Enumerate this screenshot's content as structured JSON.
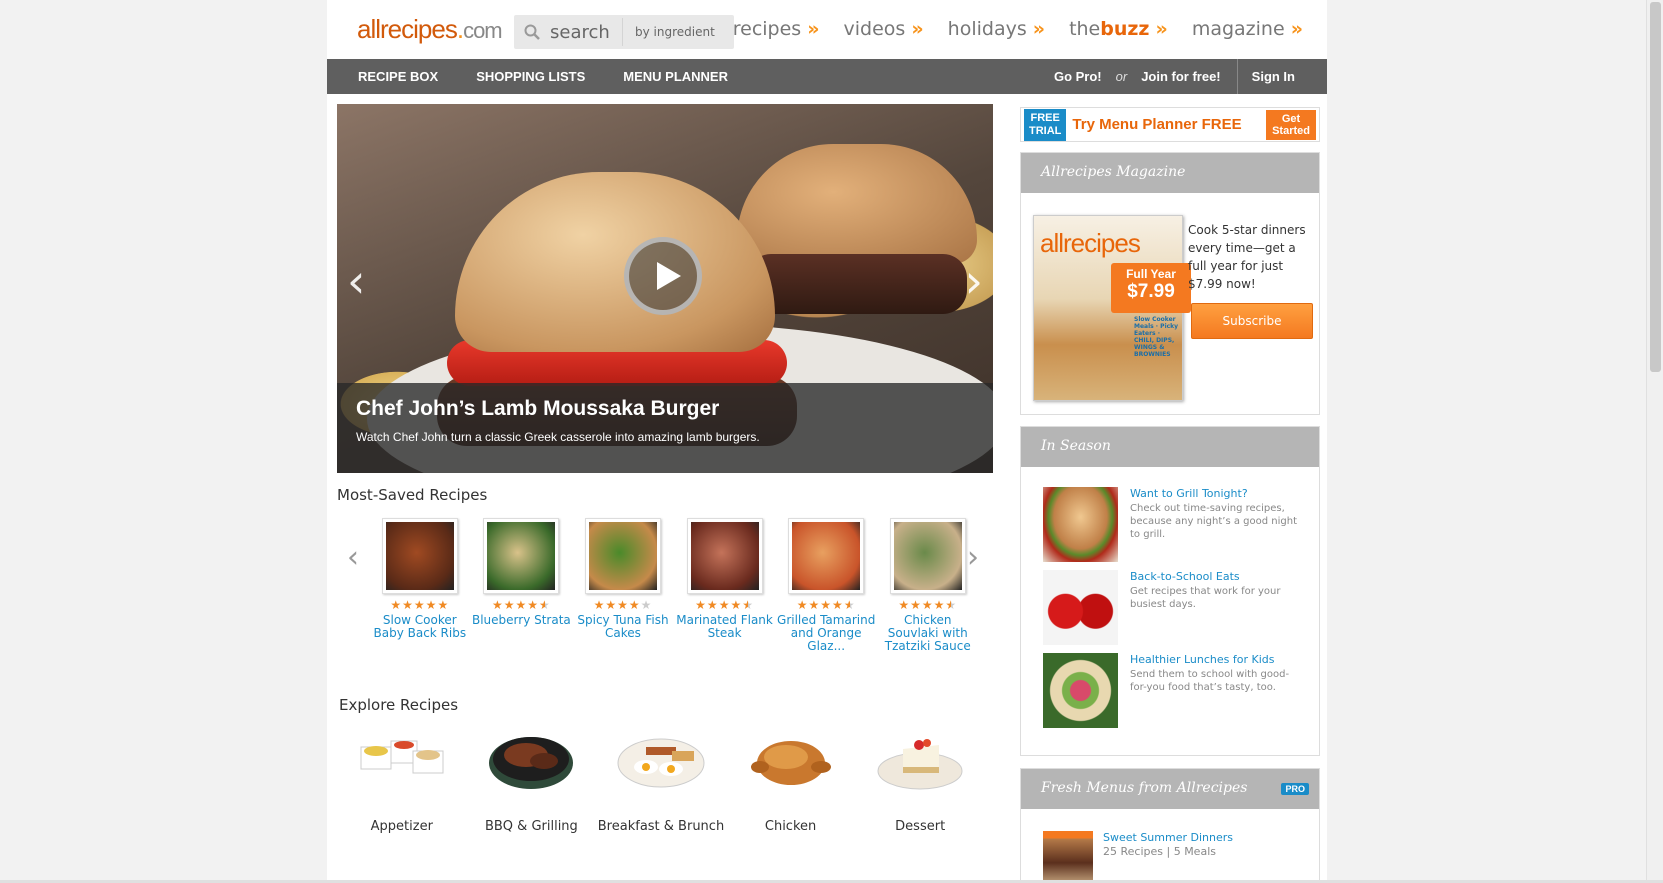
{
  "header": {
    "logo": {
      "main": "allrecipes",
      "dot": ".",
      "com": "com"
    },
    "search": {
      "placeholder": "search",
      "by_ingredient": "by ingredient"
    },
    "nav": [
      {
        "label": "recipes",
        "arrow": "»"
      },
      {
        "label": "videos",
        "arrow": "»"
      },
      {
        "label": "holidays",
        "arrow": "»"
      },
      {
        "label_prefix": "the",
        "label_suffix": "buzz",
        "arrow": "»"
      },
      {
        "label": "magazine",
        "arrow": "»"
      }
    ]
  },
  "subnav": {
    "left": [
      "RECIPE BOX",
      "SHOPPING LISTS",
      "MENU PLANNER"
    ],
    "go_pro": "Go Pro!",
    "or": "or",
    "join": "Join for free!",
    "sign_in": "Sign In"
  },
  "hero": {
    "title": "Chef John’s Lamb Moussaka Burger",
    "subtitle": "Watch Chef John turn a classic Greek casserole into amazing lamb burgers.",
    "prev": "‹",
    "next": "›"
  },
  "most_saved": {
    "title": "Most-Saved Recipes",
    "prev": "‹",
    "next": "›",
    "items": [
      {
        "name": "Slow Cooker Baby Back Ribs",
        "rating": 5,
        "color_a": "#5a2a17",
        "color_b": "#a04a22"
      },
      {
        "name": "Blueberry Strata",
        "rating": 4.5,
        "color_a": "#3a6a2a",
        "color_b": "#d9c28a"
      },
      {
        "name": "Spicy Tuna Fish Cakes",
        "rating": 4,
        "color_a": "#c58a4a",
        "color_b": "#4a8a2a"
      },
      {
        "name": "Marinated Flank Steak",
        "rating": 4.5,
        "color_a": "#6a2a1e",
        "color_b": "#c4735a"
      },
      {
        "name": "Grilled Tamarind and Orange Glaz...",
        "rating": 4.5,
        "color_a": "#c9542a",
        "color_b": "#e8a060"
      },
      {
        "name": "Chicken Souvlaki with Tzatziki Sauce",
        "rating": 4.5,
        "color_a": "#c8b08a",
        "color_b": "#6a8a4a"
      }
    ]
  },
  "explore": {
    "title": "Explore Recipes",
    "items": [
      {
        "name": "Appetizer"
      },
      {
        "name": "BBQ & Grilling"
      },
      {
        "name": "Breakfast & Brunch"
      },
      {
        "name": "Chicken"
      },
      {
        "name": "Dessert"
      }
    ]
  },
  "sidebar": {
    "trial": {
      "badge_line1": "FREE",
      "badge_line2": "TRIAL",
      "text": "Try Menu Planner FREE",
      "cta_line1": "Get",
      "cta_line2": "Started"
    },
    "magazine": {
      "title": "Allrecipes Magazine",
      "cover_title": "allrecipes",
      "cover_teaser": "Slow Cooker Meals · Picky Eaters · CHILI, DIPS, WINGS & BROWNIES",
      "badge_line1": "Full Year",
      "badge_price": "$7.99",
      "desc": "Cook 5-star dinners every time—get a full year for just $7.99 now!",
      "subscribe": "Subscribe"
    },
    "in_season": {
      "title": "In Season",
      "items": [
        {
          "title": "Want to Grill Tonight?",
          "desc": "Check out time-saving recipes, because any night’s a good night to grill."
        },
        {
          "title": "Back-to-School Eats",
          "desc": "Get recipes that work for your busiest days."
        },
        {
          "title": "Healthier Lunches for Kids",
          "desc": "Send them to school with good-for-you food that’s tasty, too."
        }
      ]
    },
    "fresh_menus": {
      "title": "Fresh Menus from Allrecipes",
      "pro_badge": "PRO",
      "item_title": "Sweet Summer Dinners",
      "item_desc": "25 Recipes | 5 Meals"
    }
  },
  "colors": {
    "brand_orange": "#f47920",
    "link_blue": "#1a8cc8",
    "subnav_gray": "#5f5f5f"
  }
}
